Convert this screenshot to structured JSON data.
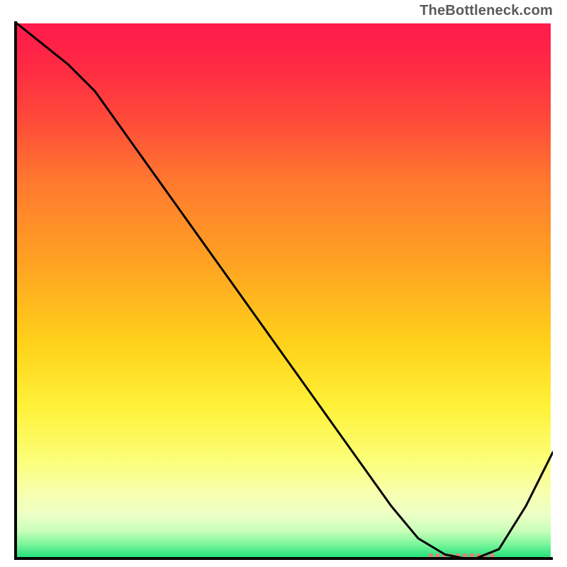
{
  "watermark": "TheBottleneck.com",
  "chart_data": {
    "type": "line",
    "title": "",
    "xlabel": "",
    "ylabel": "",
    "xlim": [
      0,
      100
    ],
    "ylim": [
      0,
      100
    ],
    "grid": false,
    "series": [
      {
        "name": "curve",
        "x": [
          0,
          5,
          10,
          15,
          20,
          25,
          30,
          35,
          40,
          45,
          50,
          55,
          60,
          65,
          70,
          75,
          80,
          85,
          90,
          95,
          100
        ],
        "y": [
          100,
          96,
          92,
          87,
          80,
          73,
          66,
          59,
          52,
          45,
          38,
          31,
          24,
          17,
          10,
          4,
          1,
          0,
          2,
          10,
          20
        ]
      }
    ],
    "optimal_marker": {
      "x_start": 77,
      "x_end": 89,
      "y": 0.8,
      "color": "#ee7a72"
    },
    "gradient_stops": [
      {
        "offset": 0.0,
        "color": "#ff1a4b"
      },
      {
        "offset": 0.08,
        "color": "#ff2a44"
      },
      {
        "offset": 0.18,
        "color": "#ff4a3a"
      },
      {
        "offset": 0.3,
        "color": "#ff7a2e"
      },
      {
        "offset": 0.45,
        "color": "#ffa322"
      },
      {
        "offset": 0.6,
        "color": "#ffd21a"
      },
      {
        "offset": 0.72,
        "color": "#fff23a"
      },
      {
        "offset": 0.82,
        "color": "#fbff7a"
      },
      {
        "offset": 0.88,
        "color": "#f7ffb0"
      },
      {
        "offset": 0.92,
        "color": "#ecffc5"
      },
      {
        "offset": 0.95,
        "color": "#c8ffb8"
      },
      {
        "offset": 0.975,
        "color": "#7af59a"
      },
      {
        "offset": 1.0,
        "color": "#1fe07a"
      }
    ],
    "axis_color": "#000000",
    "axis_width": 4,
    "line_color": "#000000",
    "line_width": 3
  }
}
